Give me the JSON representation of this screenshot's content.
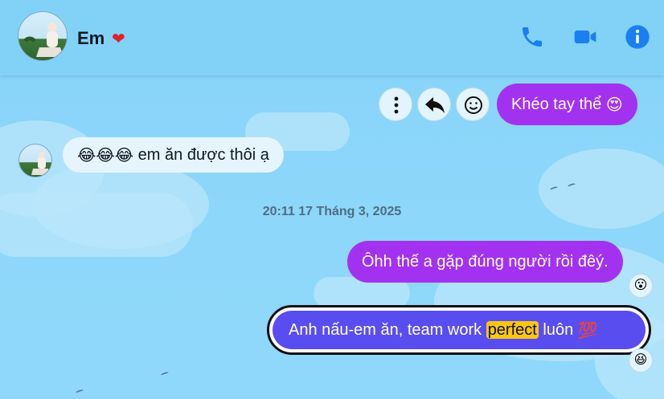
{
  "header": {
    "contact_name": "Em",
    "heart": "❤",
    "actions": [
      "phone-icon",
      "video-call-icon",
      "info-icon"
    ]
  },
  "messages": [
    {
      "id": "m1",
      "from": "me",
      "text": "Khéo tay thể",
      "emoji_suffix": "😍"
    },
    {
      "id": "m2",
      "from": "them",
      "emoji_prefix": "😂😂😂",
      "text": "em ăn được thôi ạ"
    },
    {
      "id": "m3",
      "from": "me",
      "text": "Ôhh thế a gặp đúng người rồi đêý.",
      "reaction": "😮"
    },
    {
      "id": "m4",
      "from": "me",
      "text_before": "Anh nấu-em ăn, team work ",
      "highlight": "perfect",
      "text_after": " luôn",
      "emoji_suffix": "💯",
      "reaction": "😆"
    }
  ],
  "timestamp": "20:11 17 Tháng 3, 2025",
  "message_actions": [
    "more-options-icon",
    "reply-icon",
    "react-icon"
  ],
  "colors": {
    "sent_bubble": "#a332f0",
    "selected_bubble": "#5a4df0",
    "received_bubble": "#e6f5fd",
    "header_bg": "#82d2f8",
    "accent_icon": "#1a7ff0"
  }
}
